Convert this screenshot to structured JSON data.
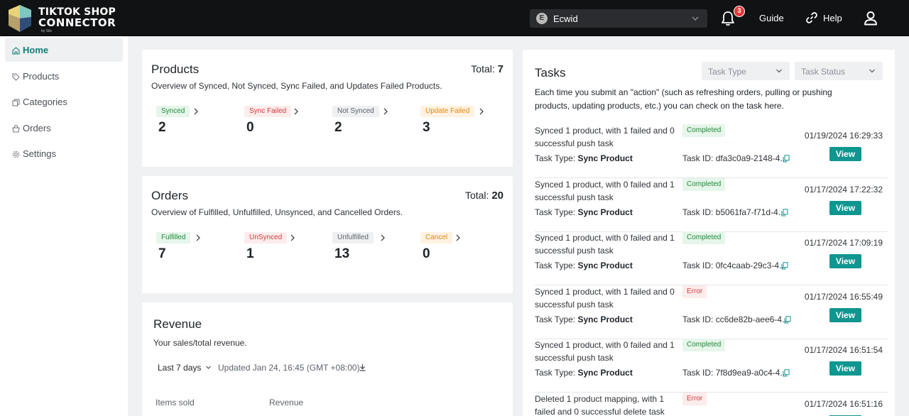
{
  "header": {
    "logo_line1": "TIKTOK SHOP",
    "logo_line2": "CONNECTOR",
    "logo_sub": "by Stix",
    "store_initial": "E",
    "store_name": "Ecwid",
    "notification_count": "3",
    "guide_label": "Guide",
    "help_label": "Help"
  },
  "sidebar": {
    "items": [
      {
        "label": "Home",
        "icon": "home-icon",
        "active": true
      },
      {
        "label": "Products",
        "icon": "tag-icon"
      },
      {
        "label": "Categories",
        "icon": "categories-icon"
      },
      {
        "label": "Orders",
        "icon": "orders-icon"
      },
      {
        "label": "Settings",
        "icon": "gear-icon"
      }
    ]
  },
  "products": {
    "title": "Products",
    "subtitle": "Overview of Synced, Not Synced, Sync Failed, and Updates Failed Products.",
    "total_label": "Total:",
    "total_value": "7",
    "stats": [
      {
        "label": "Synced",
        "value": "2"
      },
      {
        "label": "Sync Failed",
        "value": "0"
      },
      {
        "label": "Not Synced",
        "value": "2"
      },
      {
        "label": "Update Failed",
        "value": "3"
      }
    ]
  },
  "orders": {
    "title": "Orders",
    "subtitle": "Overview of Fulfilled, Unfulfilled, Unsynced, and Cancelled Orders.",
    "total_label": "Total:",
    "total_value": "20",
    "stats": [
      {
        "label": "Fulfilled",
        "value": "7"
      },
      {
        "label": "UnSynced",
        "value": "1"
      },
      {
        "label": "Unfulfilled",
        "value": "13"
      },
      {
        "label": "Cancel",
        "value": "0"
      }
    ]
  },
  "revenue": {
    "title": "Revenue",
    "subtitle": "Your sales/total revenue.",
    "range": "Last 7 days",
    "updated": "Updated Jan 24, 16:45 (GMT +08:00)",
    "col_items": "Items sold",
    "col_revenue": "Revenue"
  },
  "tasks": {
    "title": "Tasks",
    "type_placeholder": "Task Type",
    "status_placeholder": "Task Status",
    "description": "Each time you submit an \"action\" (such as refreshing orders, pulling or pushing products, updating products, etc.) you can check on the task here.",
    "type_label": "Task Type:",
    "id_label": "Task ID:",
    "view_label": "View",
    "items": [
      {
        "text": "Synced 1 product, with 1 failed and 0 successful push task",
        "status": "Completed",
        "type": "Sync Product",
        "id": "dfa3c0a9-2148-4...",
        "date": "01/19/2024 16:29:33"
      },
      {
        "text": "Synced 1 product, with 0 failed and 1 successful push task",
        "status": "Completed",
        "type": "Sync Product",
        "id": "b5061fa7-f71d-4...",
        "date": "01/17/2024 17:22:32"
      },
      {
        "text": "Synced 1 product, with 0 failed and 1 successful push task",
        "status": "Completed",
        "type": "Sync Product",
        "id": "0fc4caab-29c3-4...",
        "date": "01/17/2024 17:09:19"
      },
      {
        "text": "Synced 1 product, with 1 failed and 0 successful push task",
        "status": "Error",
        "type": "Sync Product",
        "id": "cc6de82b-aee6-4...",
        "date": "01/17/2024 16:55:49"
      },
      {
        "text": "Synced 1 product, with 0 failed and 1 successful push task",
        "status": "Completed",
        "type": "Sync Product",
        "id": "7f8d9ea9-a0c4-4...",
        "date": "01/17/2024 16:51:54"
      },
      {
        "text": "Deleted 1 product mapping, with 1 failed and 0 successful delete task",
        "status": "Error",
        "date": "01/17/2024 16:51:16"
      }
    ]
  }
}
